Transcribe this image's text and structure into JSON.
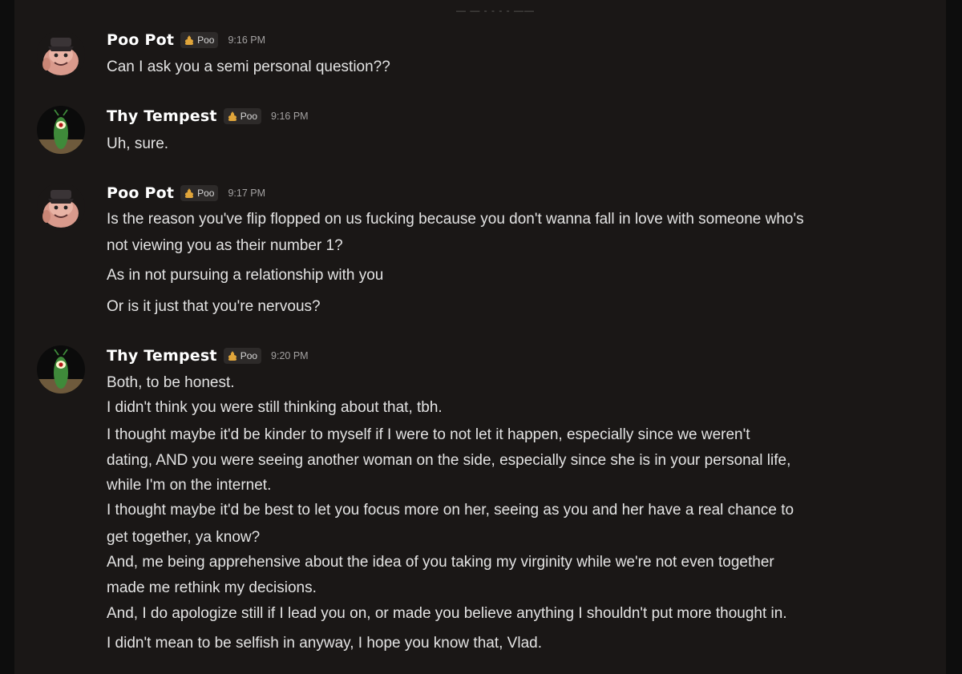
{
  "date_divider": "— — - - - - ——",
  "messages": [
    {
      "author": "Poo Pot",
      "tag": "Poo",
      "time": "9:16 PM",
      "lines": [
        "Can I ask you a semi personal question??"
      ]
    },
    {
      "author": "Thy Tempest",
      "tag": "Poo",
      "time": "9:16 PM",
      "lines": [
        "Uh, sure."
      ]
    },
    {
      "author": "Poo Pot",
      "tag": "Poo",
      "time": "9:17 PM",
      "lines": [
        "Is the reason you've flip flopped on us fucking because you don't wanna fall in love with someone who's",
        "not viewing you as their number 1?",
        "As in not pursuing a relationship with you",
        "Or is it just that you're nervous?"
      ]
    },
    {
      "author": "Thy Tempest",
      "tag": "Poo",
      "time": "9:20 PM",
      "lines": [
        "Both, to be honest.",
        "I didn't think you were still thinking about that, tbh.",
        "I thought maybe it'd be kinder to myself if I were to not let it happen, especially since we weren't",
        "dating, AND you were seeing another woman on the side, especially since she is in your personal life,",
        "while I'm on the internet.",
        "I thought maybe it'd be best to let you focus more on her, seeing as you and her have a real chance to",
        "get together, ya know?",
        "And, me being apprehensive about the idea of you taking my virginity while we're not even together",
        "made me rethink my decisions.",
        "And, I do apologize still if I lead you on, or made you believe anything I shouldn't put more thought in.",
        "I didn't mean to be selfish in anyway, I hope you know that, Vlad."
      ]
    }
  ],
  "icons": {
    "tag_icon": "poo-emoji-icon",
    "poo_pot_avatar": "cartoon-character-avatar-icon",
    "thy_tempest_avatar": "plankton-avatar-icon"
  },
  "colors": {
    "background": "#1a1716",
    "username": "#ffffff",
    "message_text": "#e3e3e3",
    "timestamp": "#a3a1a1",
    "tag_background": "#2d2a29"
  }
}
